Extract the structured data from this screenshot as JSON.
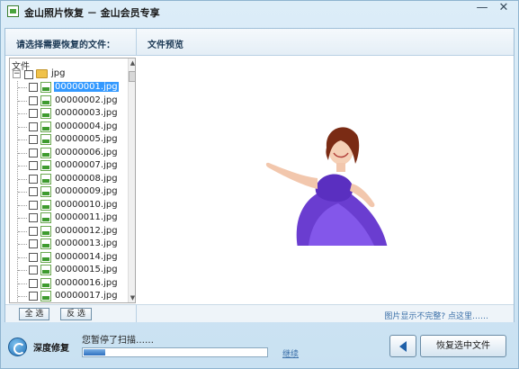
{
  "window": {
    "title": "金山照片恢复 － 金山会员专享",
    "minimize_label": "—",
    "close_label": "✕"
  },
  "left_panel": {
    "heading": "请选择需要恢复的文件：",
    "tree_header": "文件",
    "root_expander": "−",
    "root_folder": "jpg",
    "files": [
      "00000001.jpg",
      "00000002.jpg",
      "00000003.jpg",
      "00000004.jpg",
      "00000005.jpg",
      "00000006.jpg",
      "00000007.jpg",
      "00000008.jpg",
      "00000009.jpg",
      "00000010.jpg",
      "00000011.jpg",
      "00000012.jpg",
      "00000013.jpg",
      "00000014.jpg",
      "00000015.jpg",
      "00000016.jpg",
      "00000017.jpg"
    ],
    "selected_index": 0,
    "select_all_label": "全 选",
    "invert_label": "反 选"
  },
  "right_panel": {
    "heading": "文件预览",
    "incomplete_link": "图片显示不完整? 点这里……"
  },
  "bottom": {
    "mode_label": "深度修复",
    "status_text": "您暂停了扫描……",
    "progress_fraction": 0.12,
    "continue_label": "继续",
    "restore_label": "恢复选中文件"
  },
  "colors": {
    "selection": "#3399ff",
    "link": "#3a6fa8",
    "accent": "#1f6fb6"
  }
}
